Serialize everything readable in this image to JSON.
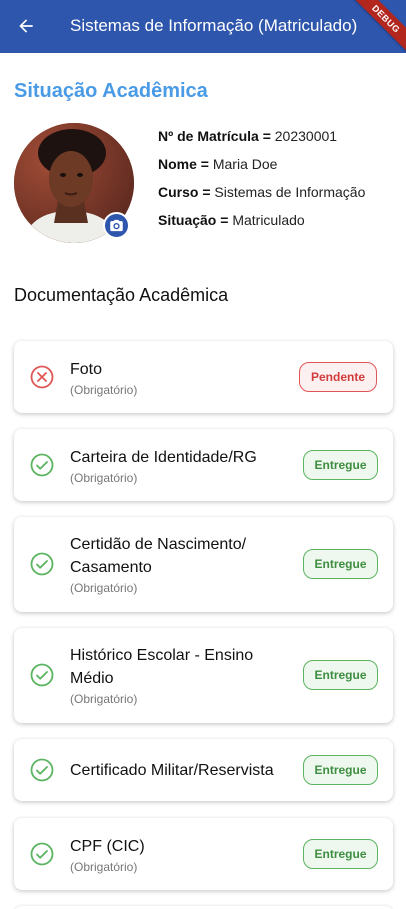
{
  "appbar": {
    "title": "Sistemas de Informação (Matriculado)",
    "debug_label": "DEBUG"
  },
  "profile": {
    "section_title": "Situação Acadêmica",
    "matricula_label": "Nº de Matrícula =",
    "matricula_value": "20230001",
    "nome_label": "Nome =",
    "nome_value": "Maria Doe",
    "curso_label": "Curso =",
    "curso_value": "Sistemas de Informação",
    "situacao_label": "Situação =",
    "situacao_value": "Matriculado"
  },
  "documents": {
    "title": "Documentação Acadêmica",
    "items": [
      {
        "name": "Foto",
        "requirement": "(Obrigatório)",
        "status": "Pendente"
      },
      {
        "name": "Carteira de Identidade/RG",
        "requirement": "(Obrigatório)",
        "status": "Entregue"
      },
      {
        "name": "Certidão de Nascimento/ Casamento",
        "requirement": "(Obrigatório)",
        "status": "Entregue"
      },
      {
        "name": "Histórico Escolar - Ensino Médio",
        "requirement": "(Obrigatório)",
        "status": "Entregue"
      },
      {
        "name": "Certificado Militar/Reservista",
        "requirement": "",
        "status": "Entregue"
      },
      {
        "name": "CPF (CIC)",
        "requirement": "(Obrigatório)",
        "status": "Entregue"
      }
    ]
  },
  "colors": {
    "appbar": "#2f56ad",
    "accent": "#4a9be6",
    "success": "#5bb45f",
    "error": "#e05656"
  },
  "icons": {
    "back": "arrow-left-icon",
    "camera": "camera-icon",
    "pending": "x-circle-icon",
    "delivered": "check-circle-icon"
  }
}
